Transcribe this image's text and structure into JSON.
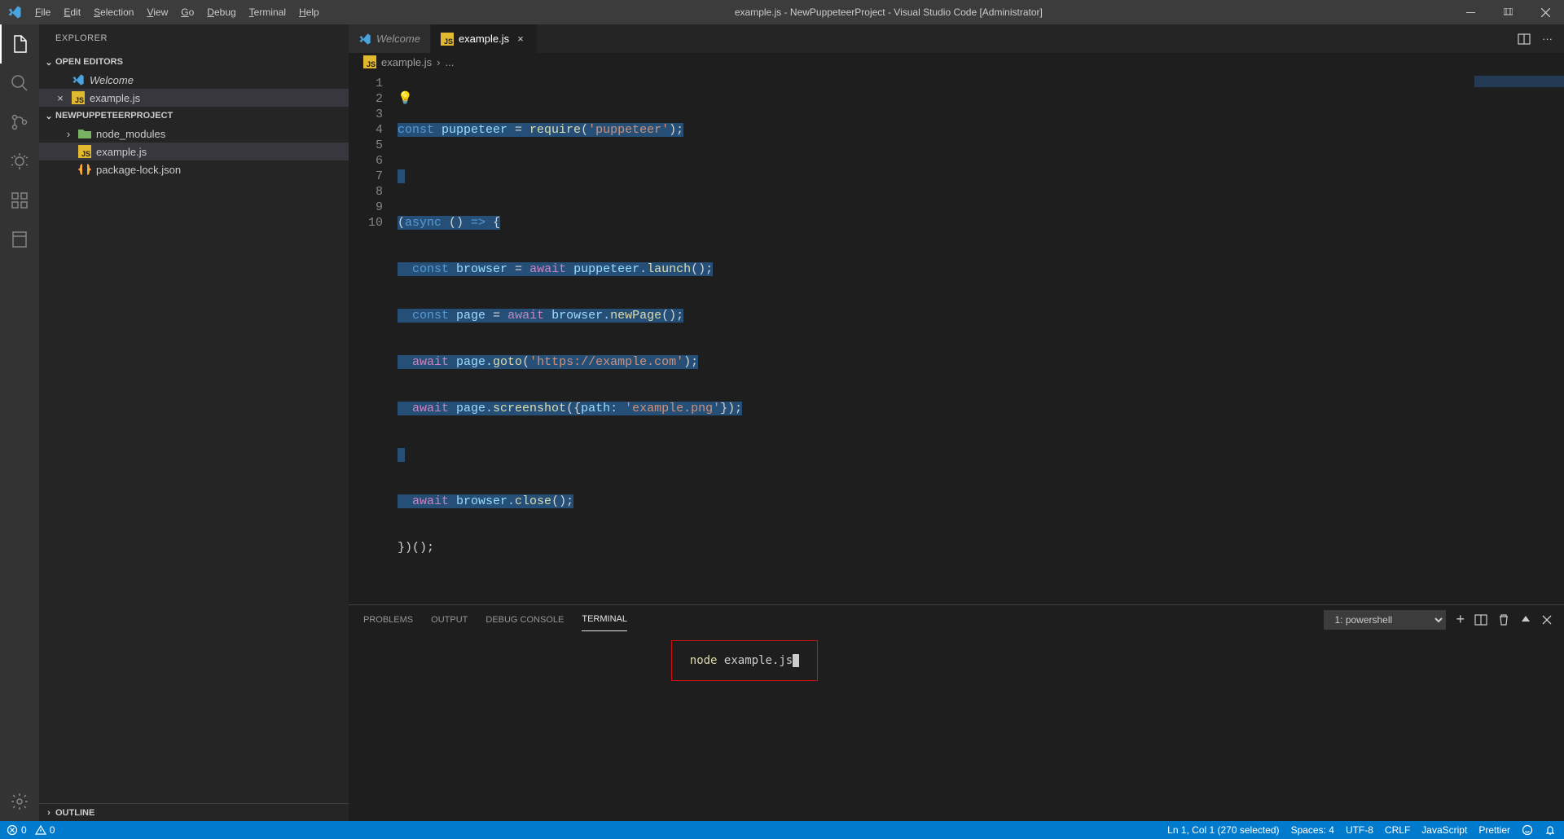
{
  "titlebar": {
    "menus": [
      "File",
      "Edit",
      "Selection",
      "View",
      "Go",
      "Debug",
      "Terminal",
      "Help"
    ],
    "title": "example.js - NewPuppeteerProject - Visual Studio Code [Administrator]"
  },
  "sidebar": {
    "title": "EXPLORER",
    "openEditors": "OPEN EDITORS",
    "openEditorItems": {
      "welcome": "Welcome",
      "example": "example.js"
    },
    "project": "NEWPUPPETEERPROJECT",
    "tree": {
      "node_modules": "node_modules",
      "example": "example.js",
      "pkglock": "package-lock.json"
    },
    "outline": "OUTLINE"
  },
  "tabs": {
    "welcome": "Welcome",
    "example": "example.js"
  },
  "breadcrumb": {
    "file": "example.js",
    "rest": "..."
  },
  "code": {
    "l1": {
      "a": "const ",
      "b": "puppeteer ",
      "c": "= ",
      "d": "require",
      "e": "(",
      "f": "'puppeteer'",
      "g": ");"
    },
    "l3": {
      "a": "(",
      "b": "async ",
      "c": "() ",
      "d": "=> ",
      "e": "{"
    },
    "l4": {
      "i": "  ",
      "a": "const ",
      "b": "browser ",
      "c": "= ",
      "d": "await ",
      "e": "puppeteer.",
      "f": "launch",
      "g": "();"
    },
    "l5": {
      "i": "  ",
      "a": "const ",
      "b": "page ",
      "c": "= ",
      "d": "await ",
      "e": "browser.",
      "f": "newPage",
      "g": "();"
    },
    "l6": {
      "i": "  ",
      "a": "await ",
      "b": "page.",
      "c": "goto",
      "d": "(",
      "e": "'https://example.com'",
      "f": ");"
    },
    "l7": {
      "i": "  ",
      "a": "await ",
      "b": "page.",
      "c": "screenshot",
      "d": "({",
      "e": "path: ",
      "f": "'example.png'",
      "g": "});"
    },
    "l9": {
      "i": "  ",
      "a": "await ",
      "b": "browser.",
      "c": "close",
      "d": "();"
    },
    "l10": {
      "a": "})();"
    }
  },
  "lineNumbers": [
    "1",
    "2",
    "3",
    "4",
    "5",
    "6",
    "7",
    "8",
    "9",
    "10"
  ],
  "panel": {
    "tabs": {
      "problems": "PROBLEMS",
      "output": "OUTPUT",
      "debug": "DEBUG CONSOLE",
      "terminal": "TERMINAL"
    },
    "select": "1: powershell",
    "cmd_a": "node ",
    "cmd_b": "example.js"
  },
  "status": {
    "err": "0",
    "warn": "0",
    "lncol": "Ln 1, Col 1 (270 selected)",
    "spaces": "Spaces: 4",
    "enc": "UTF-8",
    "eol": "CRLF",
    "lang": "JavaScript",
    "prettier": "Prettier"
  }
}
